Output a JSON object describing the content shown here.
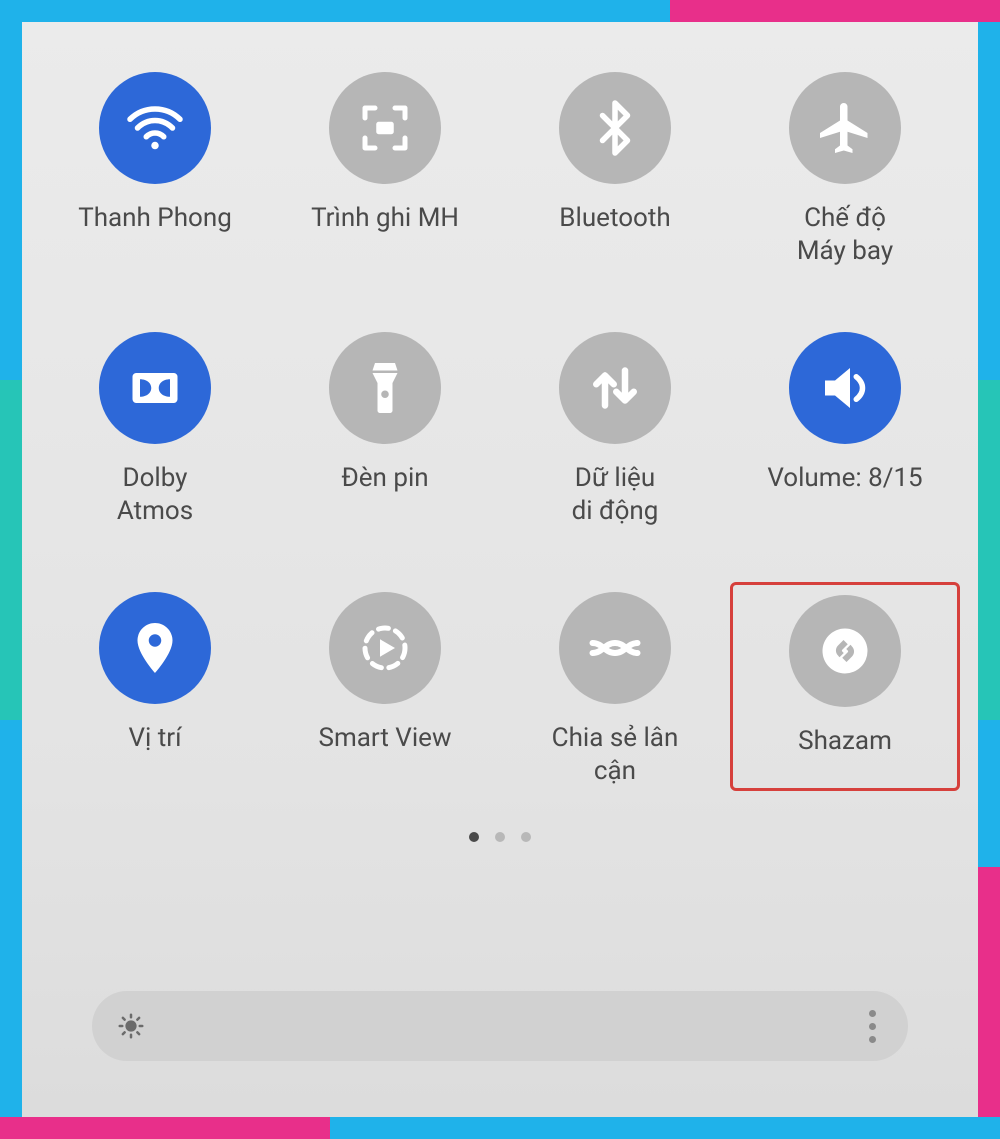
{
  "colors": {
    "accent_on": "#2d68d8",
    "accent_off": "#b6b6b6",
    "highlight_border": "#d6403c",
    "frame_blue": "#1fb2ea",
    "frame_teal": "#26c5b7",
    "frame_pink": "#e82f8a"
  },
  "tiles": [
    {
      "key": "wifi",
      "label": "Thanh Phong",
      "icon": "wifi-icon",
      "active": true
    },
    {
      "key": "screenrec",
      "label": "Trình ghi MH",
      "icon": "screenrec-icon",
      "active": false
    },
    {
      "key": "bluetooth",
      "label": "Bluetooth",
      "icon": "bluetooth-icon",
      "active": false
    },
    {
      "key": "airplane",
      "label": "Chế độ\nMáy bay",
      "icon": "airplane-icon",
      "active": false
    },
    {
      "key": "dolby",
      "label": "Dolby\nAtmos",
      "icon": "dolby-icon",
      "active": true
    },
    {
      "key": "flashlight",
      "label": "Đèn pin",
      "icon": "flashlight-icon",
      "active": false
    },
    {
      "key": "mobiledata",
      "label": "Dữ liệu\ndi động",
      "icon": "data-icon",
      "active": false
    },
    {
      "key": "volume",
      "label": "Volume: 8/15",
      "icon": "volume-icon",
      "active": true
    },
    {
      "key": "location",
      "label": "Vị trí",
      "icon": "location-icon",
      "active": true
    },
    {
      "key": "smartview",
      "label": "Smart View",
      "icon": "smartview-icon",
      "active": false
    },
    {
      "key": "nearby",
      "label": "Chia sẻ lân\ncận",
      "icon": "nearby-icon",
      "active": false
    },
    {
      "key": "shazam",
      "label": "Shazam",
      "icon": "shazam-icon",
      "active": false,
      "highlighted": true
    }
  ],
  "pagination": {
    "current": 0,
    "total": 3
  },
  "brightness": {
    "has_slider": true,
    "has_sun_icon": true,
    "has_more_menu": true
  }
}
